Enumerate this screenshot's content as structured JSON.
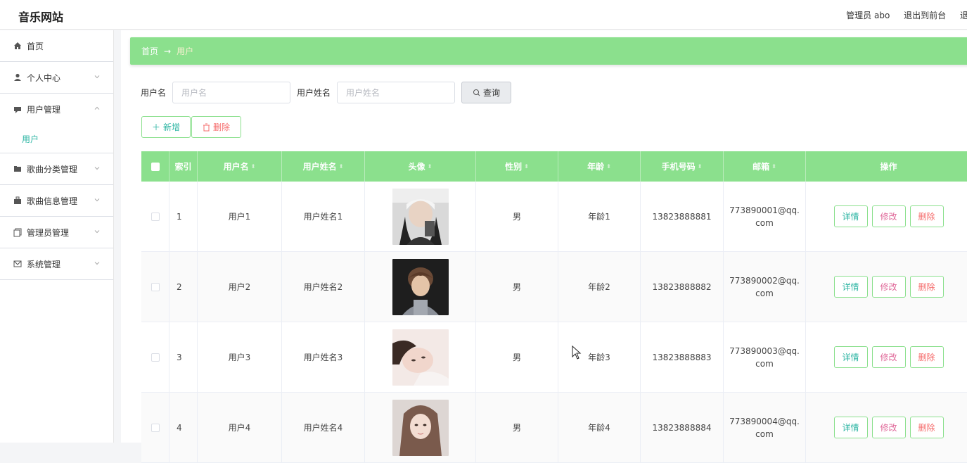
{
  "header": {
    "title": "音乐网站",
    "admin": "管理员 abo",
    "exit_front": "退出到前台",
    "exit": "退出"
  },
  "sidebar": {
    "items": [
      {
        "label": "首页",
        "icon": "home-icon"
      },
      {
        "label": "个人中心",
        "icon": "user-icon"
      },
      {
        "label": "用户管理",
        "icon": "chat-icon"
      },
      {
        "label": "歌曲分类管理",
        "icon": "folder-icon"
      },
      {
        "label": "歌曲信息管理",
        "icon": "bag-icon"
      },
      {
        "label": "管理员管理",
        "icon": "copy-icon"
      },
      {
        "label": "系统管理",
        "icon": "mail-icon"
      }
    ],
    "sub_item": "用户"
  },
  "breadcrumb": {
    "home": "首页",
    "arrow": "→",
    "current": "用户"
  },
  "search": {
    "username_label": "用户名",
    "username_placeholder": "用户名",
    "realname_label": "用户姓名",
    "realname_placeholder": "用户姓名",
    "query_label": "查询"
  },
  "actions": {
    "add_label": "新增",
    "delete_label": "删除"
  },
  "table": {
    "headers": [
      "索引",
      "用户名",
      "用户姓名",
      "头像",
      "性别",
      "年龄",
      "手机号码",
      "邮箱",
      "操作"
    ],
    "rows": [
      {
        "index": "1",
        "username": "用户1",
        "realname": "用户姓名1",
        "gender": "男",
        "age": "年龄1",
        "phone": "13823888881",
        "email": "773890001@qq.com"
      },
      {
        "index": "2",
        "username": "用户2",
        "realname": "用户姓名2",
        "gender": "男",
        "age": "年龄2",
        "phone": "13823888882",
        "email": "773890002@qq.com"
      },
      {
        "index": "3",
        "username": "用户3",
        "realname": "用户姓名3",
        "gender": "男",
        "age": "年龄3",
        "phone": "13823888883",
        "email": "773890003@qq.com"
      },
      {
        "index": "4",
        "username": "用户4",
        "realname": "用户姓名4",
        "gender": "男",
        "age": "年龄4",
        "phone": "13823888884",
        "email": "773890004@qq.com"
      }
    ],
    "op_detail": "详情",
    "op_edit": "修改",
    "op_delete": "删除"
  },
  "colors": {
    "accent": "#8be08d",
    "teal": "#2fb6a4",
    "danger": "#f56c6c"
  }
}
